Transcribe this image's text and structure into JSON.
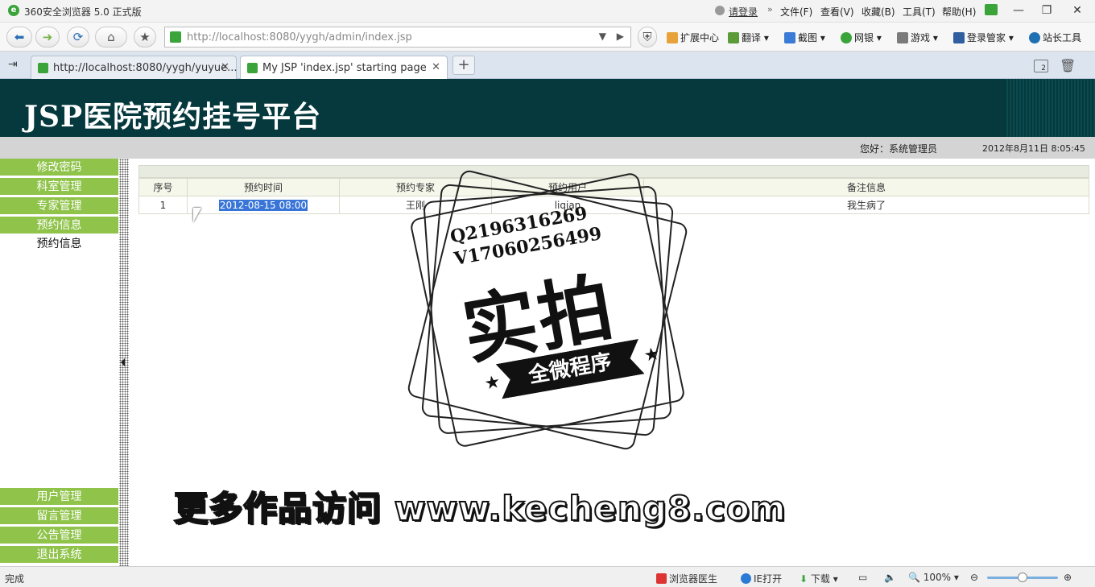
{
  "browser": {
    "title": "360安全浏览器 5.0 正式版",
    "login": "请登录",
    "menus": [
      "文件(F)",
      "查看(V)",
      "收藏(B)",
      "工具(T)",
      "帮助(H)"
    ],
    "address_url": "http://localhost:8080/yygh/admin/index.jsp",
    "toolbar": [
      "扩展中心",
      "翻译",
      "截图",
      "网银",
      "游戏",
      "登录管家",
      "站长工具"
    ],
    "tabs": [
      {
        "label": "http://localhost:8080/yygh/yuyue..."
      },
      {
        "label": "My JSP 'index.jsp' starting page"
      }
    ],
    "tab_count": "2"
  },
  "page": {
    "title": "JSP医院预约挂号平台",
    "greeting": "您好：系统管理员",
    "datetime": "2012年8月11日  8:05:45"
  },
  "menu": {
    "top": [
      "修改密码",
      "科室管理",
      "专家管理",
      "预约信息"
    ],
    "sub": "预约信息",
    "bottom": [
      "用户管理",
      "留言管理",
      "公告管理",
      "退出系统"
    ]
  },
  "table": {
    "headers": [
      "序号",
      "预约时间",
      "预约专家",
      "预约用户",
      "备注信息"
    ],
    "rows": [
      [
        "1",
        "2012-08-15 08:00",
        "王刚",
        "liqian",
        "我生病了"
      ]
    ]
  },
  "watermark": {
    "qq": "Q2196316269",
    "vx": "V17060256499",
    "big": "实拍",
    "ribbon": "全微程序",
    "promo": "更多作品访问 www.kecheng8.com"
  },
  "status": {
    "done": "完成",
    "doctor": "浏览器医生",
    "ie": "IE打开",
    "download": "下载",
    "zoom": "100%"
  },
  "colors": {
    "header_bg": "#06393d",
    "menu_green": "#8fc34a",
    "selection": "#3875d7"
  }
}
